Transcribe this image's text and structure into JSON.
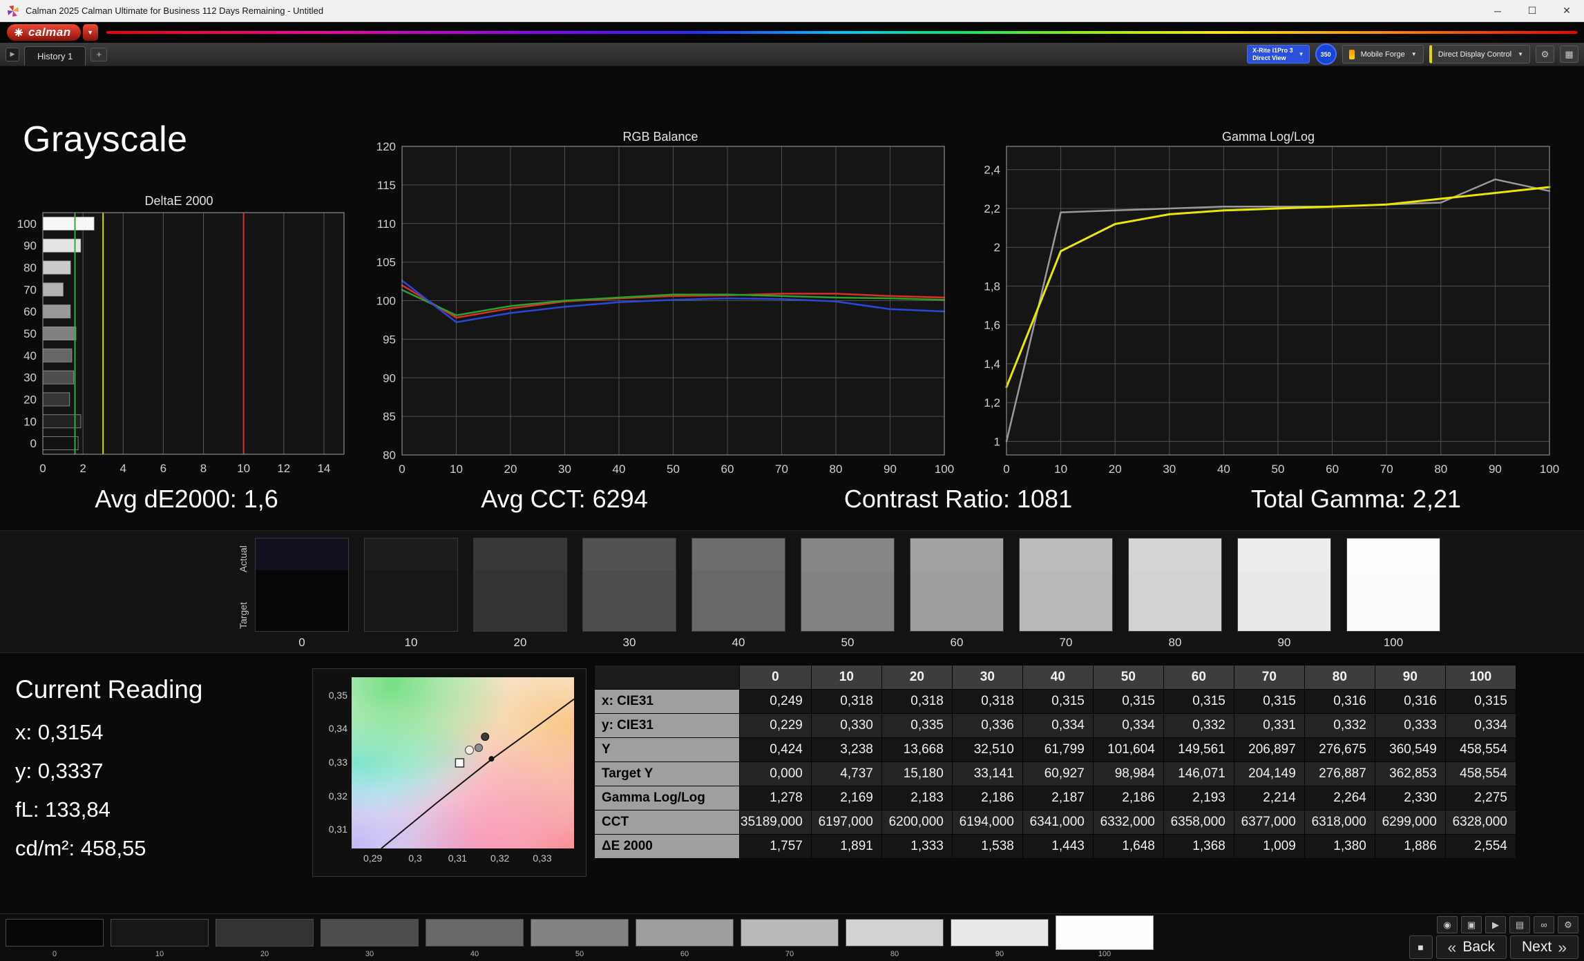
{
  "window": {
    "title": "Calman 2025 Calman Ultimate for Business 112 Days Remaining - Untitled",
    "brand": "calman",
    "controls": {
      "minimize": "─",
      "maximize": "☐",
      "close": "✕"
    }
  },
  "toolbar": {
    "nav_arrow": "▶",
    "history_tab": "History 1",
    "add_tab": "+",
    "meter_line1": "X-Rite i1Pro 3",
    "meter_line2": "Direct View",
    "badge": "350",
    "source_label": "Mobile Forge",
    "display_label": "Direct Display Control",
    "caret": "▼",
    "gear_icon": "⚙",
    "layout_icon": "▦"
  },
  "page": {
    "title": "Grayscale"
  },
  "stats": [
    "Avg dE2000: 1,6",
    "Avg CCT: 6294",
    "Contrast Ratio: 1081",
    "Total Gamma: 2,21"
  ],
  "current_reading": {
    "title": "Current Reading",
    "lines": [
      "x: 0,3154",
      "y: 0,3337",
      "fL: 133,84",
      "cd/m²: 458,55"
    ]
  },
  "swatches": {
    "row_labels": [
      "Actual",
      "Target"
    ],
    "levels": [
      "0",
      "10",
      "20",
      "30",
      "40",
      "50",
      "60",
      "70",
      "80",
      "90",
      "100"
    ],
    "actual_colors": [
      "#10101e",
      "#1d1d1d",
      "#383838",
      "#525252",
      "#6d6d6d",
      "#878787",
      "#a2a2a2",
      "#bcbcbc",
      "#d5d5d5",
      "#ececec",
      "#fefefe"
    ],
    "target_colors": [
      "#060606",
      "#171717",
      "#333333",
      "#4d4d4d",
      "#686868",
      "#838383",
      "#9e9e9e",
      "#b9b9b9",
      "#d2d2d2",
      "#e9e9e9",
      "#fcfcfc"
    ]
  },
  "table": {
    "col_headers": [
      "",
      "0",
      "10",
      "20",
      "30",
      "40",
      "50",
      "60",
      "70",
      "80",
      "90",
      "100"
    ],
    "rows": [
      {
        "label": "x: CIE31",
        "values": [
          "0,249",
          "0,318",
          "0,318",
          "0,318",
          "0,315",
          "0,315",
          "0,315",
          "0,315",
          "0,316",
          "0,316",
          "0,315"
        ]
      },
      {
        "label": "y: CIE31",
        "values": [
          "0,229",
          "0,330",
          "0,335",
          "0,336",
          "0,334",
          "0,334",
          "0,332",
          "0,331",
          "0,332",
          "0,333",
          "0,334"
        ]
      },
      {
        "label": "Y",
        "values": [
          "0,424",
          "3,238",
          "13,668",
          "32,510",
          "61,799",
          "101,604",
          "149,561",
          "206,897",
          "276,675",
          "360,549",
          "458,554"
        ]
      },
      {
        "label": "Target Y",
        "values": [
          "0,000",
          "4,737",
          "15,180",
          "33,141",
          "60,927",
          "98,984",
          "146,071",
          "204,149",
          "276,887",
          "362,853",
          "458,554"
        ]
      },
      {
        "label": "Gamma Log/Log",
        "values": [
          "1,278",
          "2,169",
          "2,183",
          "2,186",
          "2,187",
          "2,186",
          "2,193",
          "2,214",
          "2,264",
          "2,330",
          "2,275"
        ]
      },
      {
        "label": "CCT",
        "values": [
          "35189,000",
          "6197,000",
          "6200,000",
          "6194,000",
          "6341,000",
          "6332,000",
          "6358,000",
          "6377,000",
          "6318,000",
          "6299,000",
          "6328,000"
        ]
      },
      {
        "label": "ΔE 2000",
        "values": [
          "1,757",
          "1,891",
          "1,333",
          "1,538",
          "1,443",
          "1,648",
          "1,368",
          "1,009",
          "1,380",
          "1,886",
          "2,554"
        ]
      }
    ]
  },
  "chart_data": [
    {
      "id": "deltaE",
      "type": "bar",
      "title": "DeltaE 2000",
      "orientation": "horizontal",
      "categories": [
        100,
        90,
        80,
        70,
        60,
        50,
        40,
        30,
        20,
        10,
        0
      ],
      "values": [
        2.554,
        1.886,
        1.38,
        1.009,
        1.368,
        1.648,
        1.443,
        1.538,
        1.333,
        1.891,
        1.757
      ],
      "bar_colors": [
        "#f6f6f6",
        "#e4e4e4",
        "#cbcbcb",
        "#b2b2b2",
        "#999999",
        "#808080",
        "#676767",
        "#4e4e4e",
        "#363636",
        "#222222",
        "#121212"
      ],
      "xlim": [
        0,
        15
      ],
      "xticks": [
        0,
        2,
        4,
        6,
        8,
        10,
        12,
        14
      ],
      "ref_lines": [
        {
          "x": 1.6,
          "color": "#2fae3a"
        },
        {
          "x": 3.0,
          "color": "#d8d800"
        },
        {
          "x": 10.0,
          "color": "#d03030"
        }
      ]
    },
    {
      "id": "rgb",
      "type": "line",
      "title": "RGB Balance",
      "x": [
        0,
        10,
        20,
        30,
        40,
        50,
        60,
        70,
        80,
        90,
        100
      ],
      "ylim": [
        80,
        120
      ],
      "yticks": [
        80,
        85,
        90,
        95,
        100,
        105,
        110,
        115,
        120
      ],
      "ytick_labels": [
        "80",
        "85",
        "90",
        "95",
        "100",
        "105",
        "110",
        "115",
        "120"
      ],
      "series": [
        {
          "name": "red",
          "color": "#d93025",
          "values": [
            102.0,
            97.8,
            99.0,
            99.9,
            100.3,
            100.6,
            100.7,
            100.9,
            100.9,
            100.6,
            100.4
          ]
        },
        {
          "name": "green",
          "color": "#2ba32b",
          "values": [
            101.4,
            98.1,
            99.3,
            100.0,
            100.4,
            100.8,
            100.8,
            100.6,
            100.4,
            100.3,
            100.1
          ]
        },
        {
          "name": "blue",
          "color": "#2b48d9",
          "values": [
            102.6,
            97.2,
            98.4,
            99.2,
            99.8,
            100.1,
            100.3,
            100.2,
            99.9,
            98.9,
            98.6
          ]
        }
      ]
    },
    {
      "id": "gamma",
      "type": "line",
      "title": "Gamma Log/Log",
      "x": [
        0,
        10,
        20,
        30,
        40,
        50,
        60,
        70,
        80,
        90,
        100
      ],
      "ylim": [
        0.93,
        2.52
      ],
      "yticks": [
        1,
        1.2,
        1.4,
        1.6,
        1.8,
        2,
        2.2,
        2.4
      ],
      "ytick_labels": [
        "1",
        "1,2",
        "1,4",
        "1,6",
        "1,8",
        "2",
        "2,2",
        "2,4"
      ],
      "series": [
        {
          "name": "reference",
          "color": "#9a9a9a",
          "values": [
            1.0,
            2.18,
            2.19,
            2.2,
            2.21,
            2.21,
            2.21,
            2.22,
            2.23,
            2.35,
            2.29
          ]
        },
        {
          "name": "measured",
          "color": "#e8e800",
          "width": 3,
          "values": [
            1.28,
            1.98,
            2.12,
            2.17,
            2.19,
            2.2,
            2.21,
            2.22,
            2.25,
            2.28,
            2.31
          ]
        }
      ]
    },
    {
      "id": "cie",
      "type": "scatter",
      "title": "",
      "xlim": [
        0.285,
        0.3375
      ],
      "ylim": [
        0.3045,
        0.3555
      ],
      "xticks": [
        0.29,
        0.3,
        0.31,
        0.32,
        0.33
      ],
      "xtick_labels": [
        "0,29",
        "0,3",
        "0,31",
        "0,32",
        "0,33"
      ],
      "yticks": [
        0.31,
        0.32,
        0.33,
        0.34,
        0.35
      ],
      "ytick_labels": [
        "0,31",
        "0,32",
        "0,33",
        "0,34",
        "0,35"
      ],
      "locus": [
        [
          0.292,
          0.3045
        ],
        [
          0.305,
          0.318
        ],
        [
          0.318,
          0.331
        ],
        [
          0.33,
          0.342
        ],
        [
          0.3375,
          0.349
        ]
      ],
      "points": [
        {
          "x": 0.3165,
          "y": 0.3378,
          "type": "dot-dark"
        },
        {
          "x": 0.315,
          "y": 0.3345,
          "type": "circle-gray"
        },
        {
          "x": 0.3128,
          "y": 0.3338,
          "type": "circle-open"
        },
        {
          "x": 0.3105,
          "y": 0.33,
          "type": "square-open"
        },
        {
          "x": 0.318,
          "y": 0.3312,
          "type": "dot-black"
        }
      ]
    }
  ],
  "bottom_bar": {
    "levels": [
      "0",
      "10",
      "20",
      "30",
      "40",
      "50",
      "60",
      "70",
      "80",
      "90",
      "100"
    ],
    "colors": [
      "#060606",
      "#171717",
      "#333333",
      "#4d4d4d",
      "#686868",
      "#838383",
      "#9e9e9e",
      "#b9b9b9",
      "#d2d2d2",
      "#e9e9e9",
      "#fdfdfd"
    ],
    "selected_index": 10,
    "transport_icons": [
      {
        "name": "snapshot",
        "glyph": "◉"
      },
      {
        "name": "flag",
        "glyph": "▣"
      },
      {
        "name": "play",
        "glyph": "▶"
      },
      {
        "name": "pattern",
        "glyph": "▤"
      },
      {
        "name": "continuous",
        "glyph": "∞"
      },
      {
        "name": "settings",
        "glyph": "⚙"
      }
    ],
    "stop_icon": "■",
    "back_icon": "«",
    "back_label": "Back",
    "next_label": "Next",
    "next_icon": "»"
  }
}
